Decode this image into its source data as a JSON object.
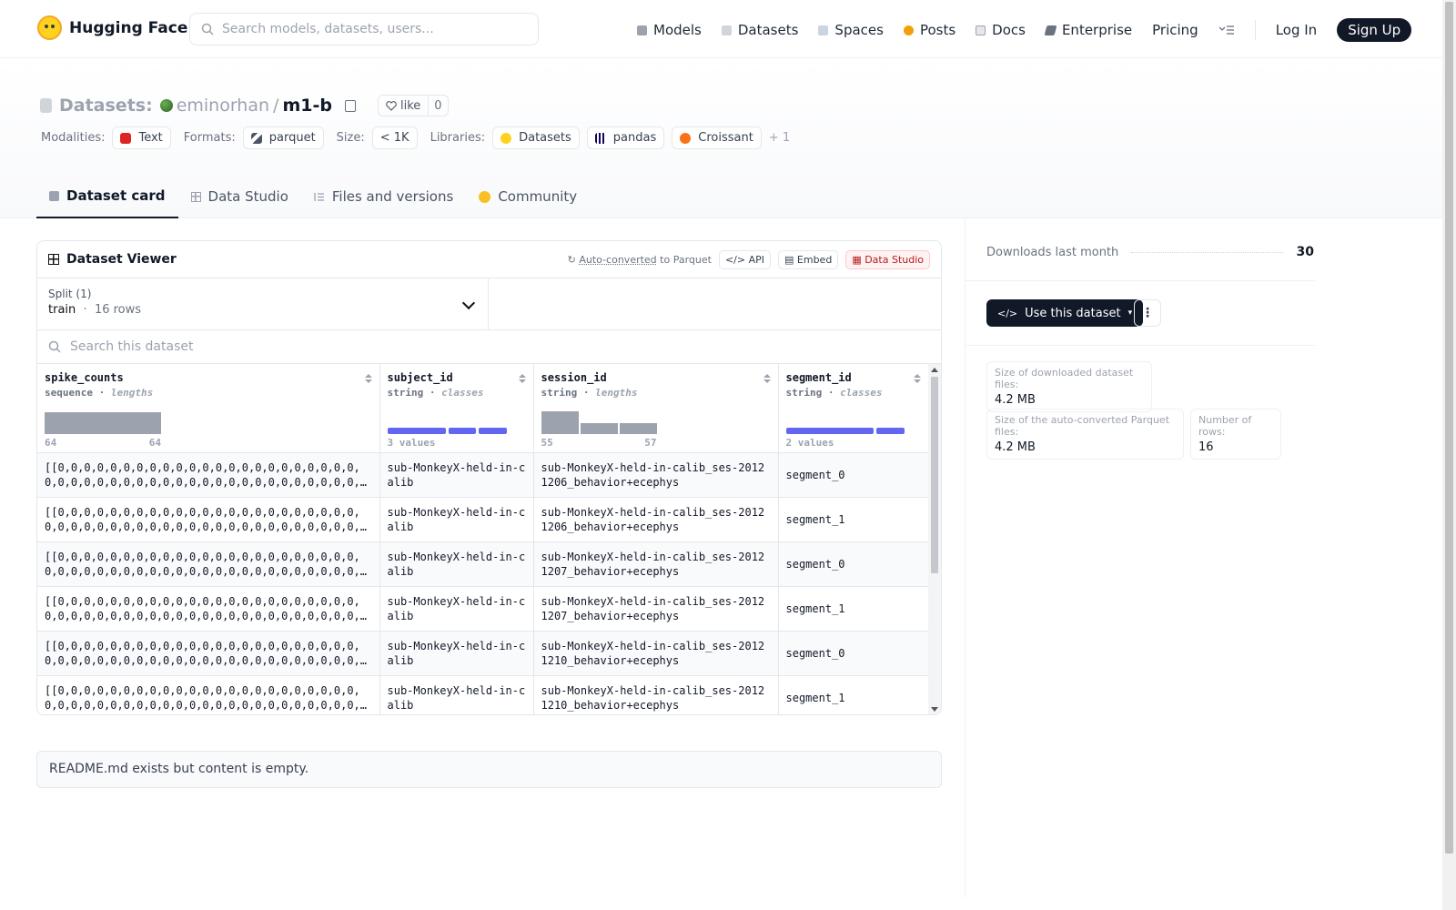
{
  "header": {
    "logo_text": "Hugging Face",
    "search_placeholder": "Search models, datasets, users...",
    "nav": [
      {
        "label": "Models",
        "icon": "cube-icon",
        "color": "#6b7280"
      },
      {
        "label": "Datasets",
        "icon": "database-icon",
        "color": "#9ca3af"
      },
      {
        "label": "Spaces",
        "icon": "grid-icon",
        "color": "#9ca3af"
      },
      {
        "label": "Posts",
        "icon": "chat-bubble-icon",
        "color": "#f59e0b"
      },
      {
        "label": "Docs",
        "icon": "book-icon",
        "color": "#9ca3af"
      },
      {
        "label": "Enterprise",
        "icon": "enterprise-icon",
        "color": "#6b7280"
      },
      {
        "label": "Pricing",
        "icon": "",
        "color": ""
      }
    ],
    "login": "Log In",
    "signup": "Sign Up"
  },
  "repo": {
    "type_label": "Datasets:",
    "owner": "eminorhan",
    "separator": "/",
    "name": "m1-b",
    "like_label": "like",
    "like_count": "0",
    "tags": {
      "modalities_label": "Modalities:",
      "modalities": [
        "Text"
      ],
      "formats_label": "Formats:",
      "formats": [
        "parquet"
      ],
      "size_label": "Size:",
      "size": "< 1K",
      "libraries_label": "Libraries:",
      "libraries": [
        "Datasets",
        "pandas",
        "Croissant"
      ],
      "libraries_more": "+ 1"
    },
    "tabs": [
      "Dataset card",
      "Data Studio",
      "Files and versions",
      "Community"
    ]
  },
  "viewer": {
    "title": "Dataset Viewer",
    "auto_converted": "Auto-converted",
    "to_parquet": "to Parquet",
    "api": "API",
    "embed": "Embed",
    "data_studio": "Data Studio",
    "split_label": "Split (1)",
    "split_name": "train",
    "split_rows": "16 rows",
    "search_placeholder": "Search this dataset",
    "columns": [
      {
        "name": "spike_counts",
        "type": "sequence",
        "stat": "lengths",
        "min": "64",
        "max": "64"
      },
      {
        "name": "subject_id",
        "type": "string",
        "stat": "classes",
        "summary": "3 values"
      },
      {
        "name": "session_id",
        "type": "string",
        "stat": "lengths",
        "min": "55",
        "max": "57"
      },
      {
        "name": "segment_id",
        "type": "string",
        "stat": "classes",
        "summary": "2 values"
      }
    ],
    "rows": [
      [
        "[[0,0,0,0,0,0,0,0,0,0,0,0,0,0,0,0,0,0,0,0,0,0,0,0,0,0,0,0,0,0,0,0,0,0,0,0,0,0,0,0,0,0,0,0,0,0,0,0,0,0,0,0,0,0,0,0,0,0,0,0,0,0,0,0",
        "sub-MonkeyX-held-in-calib",
        "sub-MonkeyX-held-in-calib_ses-20121206_behavior+ecephys",
        "segment_0"
      ],
      [
        "[[0,0,0,0,0,0,0,0,0,0,0,0,0,0,0,0,0,0,0,0,0,0,0,0,0,0,0,0,0,0,0,0,0,0,0,0,0,0,0,0,0,0,0,0,0,0,0,0,0,0,0,0,0,0,0,0,0,0,0,0,0,0,0,0",
        "sub-MonkeyX-held-in-calib",
        "sub-MonkeyX-held-in-calib_ses-20121206_behavior+ecephys",
        "segment_1"
      ],
      [
        "[[0,0,0,0,0,0,0,0,0,0,0,0,0,0,0,0,0,0,0,0,0,0,0,0,0,0,0,0,0,0,0,0,0,0,0,0,0,0,0,0,0,0,0,0,0,0,0,0,0,0,0,0,0,0,0,0,0,0,0,0,0,0,0,0",
        "sub-MonkeyX-held-in-calib",
        "sub-MonkeyX-held-in-calib_ses-20121207_behavior+ecephys",
        "segment_0"
      ],
      [
        "[[0,0,0,0,0,0,0,0,0,0,0,0,0,0,0,0,0,0,0,0,0,0,0,0,0,0,0,0,0,0,0,0,0,0,0,0,0,0,0,0,0,0,0,0,0,0,0,0,0,0,0,0,0,0,0,0,0,0,0,0,0,0,0,0",
        "sub-MonkeyX-held-in-calib",
        "sub-MonkeyX-held-in-calib_ses-20121207_behavior+ecephys",
        "segment_1"
      ],
      [
        "[[0,0,0,0,0,0,0,0,0,0,0,0,0,0,0,0,0,0,0,0,0,0,0,0,0,0,0,0,0,0,0,0,0,0,0,0,0,0,0,0,0,0,0,0,0,0,0,0,0,0,0,0,0,0,0,0,0,0,0,0,0,0,0,0",
        "sub-MonkeyX-held-in-calib",
        "sub-MonkeyX-held-in-calib_ses-20121210_behavior+ecephys",
        "segment_0"
      ],
      [
        "[[0,0,0,0,0,0,0,0,0,0,0,0,0,0,0,0,0,0,0,0,0,0,0,0,0,0,0,0,0,0,0,0,0,0,0,0,0,0,0,0,0,0,0,0,0,0,0,0,0,0,0,0,0,0,0,0,0,0,0,0,0,0,0,0",
        "sub-MonkeyX-held-in-calib",
        "sub-MonkeyX-held-in-calib_ses-20121210_behavior+ecephys",
        "segment_1"
      ]
    ]
  },
  "readme": "README.md exists but content is empty.",
  "sidebar": {
    "downloads_label": "Downloads last month",
    "downloads_value": "30",
    "use_button": "Use this dataset",
    "downloaded_size_label": "Size of downloaded dataset files:",
    "downloaded_size": "4.2 MB",
    "parquet_size_label": "Size of the auto-converted Parquet files:",
    "parquet_size": "4.2 MB",
    "rows_label": "Number of rows:",
    "rows_value": "16"
  },
  "colors": {
    "accent_bar": "#6366f1",
    "dark_button": "#111827",
    "logo_yellow": "#FFD21E"
  }
}
